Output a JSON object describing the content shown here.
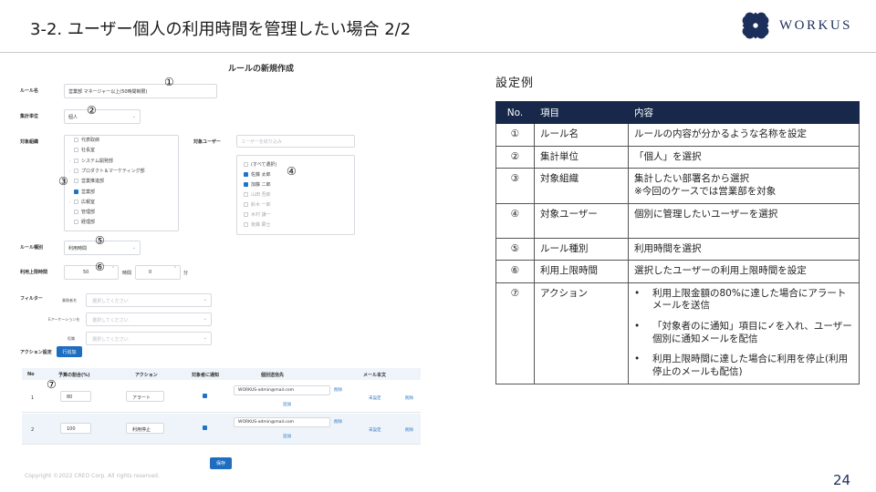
{
  "slide": {
    "title": "3-2. ユーザー個人の利用時間を管理したい場合 2/2",
    "logo_text": "WORKUS",
    "page_number": "24",
    "copyright": "Copyright ©2022 CREO Corp. All rights reserved."
  },
  "form": {
    "title": "ルールの新規作成",
    "rule_name_label": "ルール名",
    "rule_name_value": "営業部 マネージャー以上(50時間制限)",
    "aggregate_label": "集計単位",
    "aggregate_value": "個人",
    "org_label": "対象組織",
    "org_items": [
      {
        "label": "代表取締",
        "checked": false,
        "expandable": false
      },
      {
        "label": "社長室",
        "checked": false,
        "expandable": false
      },
      {
        "label": "システム開発部",
        "checked": false,
        "expandable": true
      },
      {
        "label": "プロダクト＆マーケティング部",
        "checked": false,
        "expandable": true
      },
      {
        "label": "営業推進部",
        "checked": false,
        "expandable": false
      },
      {
        "label": "営業部",
        "checked": true,
        "expandable": false
      },
      {
        "label": "広報室",
        "checked": false,
        "expandable": true
      },
      {
        "label": "管理部",
        "checked": false,
        "expandable": false
      },
      {
        "label": "経理部",
        "checked": false,
        "expandable": false
      }
    ],
    "user_label": "対象ユーザー",
    "user_search_placeholder": "ユーザーを絞り込み",
    "user_items": [
      {
        "label": "(すべて選択)",
        "checked": false,
        "dim": false
      },
      {
        "label": "佐藤 太郎",
        "checked": true,
        "dim": false
      },
      {
        "label": "加藤 二郎",
        "checked": true,
        "dim": false
      },
      {
        "label": "山田 吾郎",
        "checked": false,
        "dim": true
      },
      {
        "label": "鈴木 一郎",
        "checked": false,
        "dim": true
      },
      {
        "label": "木村 謙一",
        "checked": false,
        "dim": true
      },
      {
        "label": "後藤 顕士",
        "checked": false,
        "dim": true
      }
    ],
    "rule_type_label": "ルール種別",
    "rule_type_value": "利用時間",
    "limit_label": "利用上限時間",
    "limit_hours": "50",
    "hours_unit": "時間",
    "limit_minutes": "0",
    "minutes_unit": "分",
    "filter_label": "フィルター",
    "filters": [
      {
        "label": "業務者名",
        "placeholder": "選択してください"
      },
      {
        "label": "Eアーケーション名",
        "placeholder": "選択してください"
      },
      {
        "label": "役職",
        "placeholder": "選択してください"
      }
    ],
    "action_setting_label": "アクション設定",
    "add_row_button": "行追加",
    "table_headers": [
      "No",
      "予算の割合(%)",
      "アクション",
      "対象者に通知",
      "個別送信先",
      "メール本文"
    ],
    "rows": [
      {
        "no": "1",
        "percent": "80",
        "action": "アラート",
        "email": "WORKUS-admin@mail.com",
        "delete_label": "削除",
        "add_label": "追加",
        "mail_link": "未設定",
        "row_delete": "削除"
      },
      {
        "no": "2",
        "percent": "100",
        "action": "利用停止",
        "email": "WORKUS-admin@mail.com",
        "delete_label": "削除",
        "add_label": "追加",
        "mail_link": "未設定",
        "row_delete": "削除"
      }
    ],
    "save_button": "保存"
  },
  "markers": [
    "①",
    "②",
    "③",
    "④",
    "⑤",
    "⑥",
    "⑦"
  ],
  "example": {
    "title": "設定例",
    "headers": [
      "No.",
      "項目",
      "内容"
    ],
    "rows": [
      {
        "no": "①",
        "item": "ルール名",
        "content": [
          "ルールの内容が分かるような名称を設定"
        ]
      },
      {
        "no": "②",
        "item": "集計単位",
        "content": [
          "「個人」を選択"
        ]
      },
      {
        "no": "③",
        "item": "対象組織",
        "content": [
          "集計したい部署名から選択",
          "※今回のケースでは営業部を対象"
        ]
      },
      {
        "no": "④",
        "item": "対象ユーザー",
        "content": [
          "個別に管理したいユーザーを選択"
        ]
      },
      {
        "no": "⑤",
        "item": "ルール種別",
        "content": [
          "利用時間を選択"
        ]
      },
      {
        "no": "⑥",
        "item": "利用上限時間",
        "content": [
          "選択したユーザーの利用上限時間を設定"
        ]
      },
      {
        "no": "⑦",
        "item": "アクション",
        "bullets": [
          "利用上限金額の80%に達した場合にアラートメールを送信",
          "「対象者のに通知」項目に✓を入れ、ユーザー個別に通知メールを配信",
          "利用上限時間に達した場合に利用を停止(利用停止のメールも配信)"
        ]
      }
    ]
  },
  "colors": {
    "accent": "#1e6dc0",
    "header_navy": "#17284a",
    "logo_navy": "#1b2f5a"
  }
}
